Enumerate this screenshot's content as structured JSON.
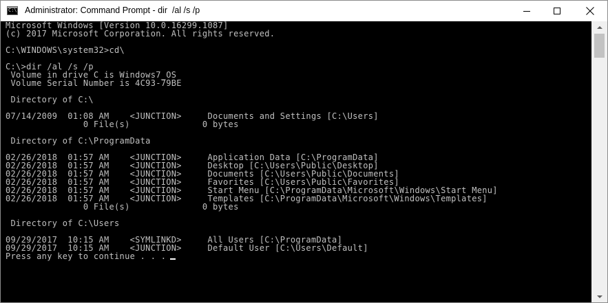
{
  "window": {
    "title": "Administrator: Command Prompt - dir  /al /s /p",
    "icon_name": "cmd-icon",
    "icon_text": "C:\\"
  },
  "controls": {
    "minimize": "minimize-icon",
    "maximize": "maximize-icon",
    "close": "close-icon"
  },
  "console": {
    "background": "#000000",
    "foreground": "#c0c0c0",
    "lines": [
      "Microsoft Windows [Version 10.0.16299.1087]",
      "(c) 2017 Microsoft Corporation. All rights reserved.",
      "",
      "C:\\WINDOWS\\system32>cd\\",
      "",
      "C:\\>dir /al /s /p",
      " Volume in drive C is Windows7_OS",
      " Volume Serial Number is 4C93-79BE",
      "",
      " Directory of C:\\",
      "",
      "07/14/2009  01:08 AM    <JUNCTION>     Documents and Settings [C:\\Users]",
      "               0 File(s)              0 bytes",
      "",
      " Directory of C:\\ProgramData",
      "",
      "02/26/2018  01:57 AM    <JUNCTION>     Application Data [C:\\ProgramData]",
      "02/26/2018  01:57 AM    <JUNCTION>     Desktop [C:\\Users\\Public\\Desktop]",
      "02/26/2018  01:57 AM    <JUNCTION>     Documents [C:\\Users\\Public\\Documents]",
      "02/26/2018  01:57 AM    <JUNCTION>     Favorites [C:\\Users\\Public\\Favorites]",
      "02/26/2018  01:57 AM    <JUNCTION>     Start Menu [C:\\ProgramData\\Microsoft\\Windows\\Start Menu]",
      "02/26/2018  01:57 AM    <JUNCTION>     Templates [C:\\ProgramData\\Microsoft\\Windows\\Templates]",
      "               0 File(s)              0 bytes",
      "",
      " Directory of C:\\Users",
      "",
      "09/29/2017  10:15 AM    <SYMLINKD>     All Users [C:\\ProgramData]",
      "09/29/2017  10:15 AM    <JUNCTION>     Default User [C:\\Users\\Default]",
      "Press any key to continue . . ."
    ]
  },
  "scrollbar": {
    "up_icon": "scroll-up-arrow-icon",
    "down_icon": "scroll-down-arrow-icon"
  }
}
